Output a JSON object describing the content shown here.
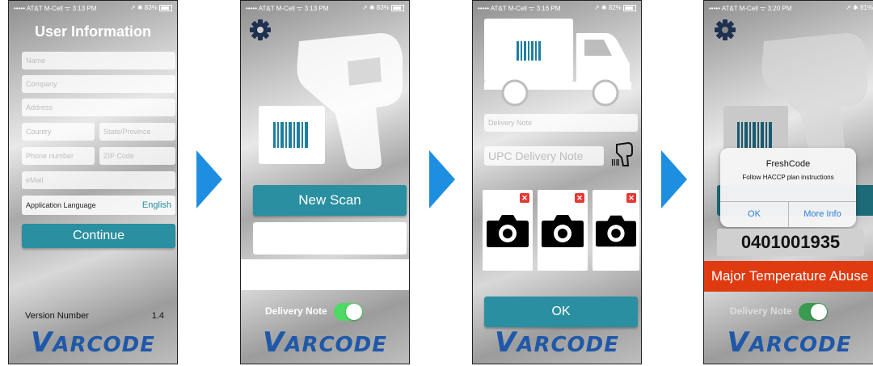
{
  "status_bars": [
    {
      "carrier": "••••• AT&T M-Cell ᯤ 3:13 PM",
      "battery": "↗ ✱ 83%"
    },
    {
      "carrier": "••••• AT&T M-Cell ᯤ 3:13 PM",
      "battery": "↗ ✱ 83%"
    },
    {
      "carrier": "••••• AT&T M-Cell ᯤ 3:16 PM",
      "battery": "↗ ✱ 82%"
    },
    {
      "carrier": "••••• AT&T M-Cell ᯤ 3:20 PM",
      "battery": "↗ ✱ 81%"
    }
  ],
  "screen1": {
    "title": "User Information",
    "placeholders": {
      "name": "Name",
      "company": "Company",
      "address": "Address",
      "country": "Country",
      "state": "State/Province",
      "phone": "Phone number",
      "zip": "ZIP Code",
      "email": "eMail"
    },
    "language_label": "Application Language",
    "language_value": "English",
    "continue_label": "Continue",
    "version_label": "Version Number",
    "version_value": "1.4"
  },
  "screen2": {
    "new_scan_label": "New Scan",
    "delivery_note_label": "Delivery Note"
  },
  "screen3": {
    "delivery_note_placeholder": "Delivery Note",
    "upc_placeholder": "UPC Delivery Note",
    "ok_label": "OK"
  },
  "screen4": {
    "dialog_title": "FreshCode",
    "dialog_message": "Follow HACCP plan instructions",
    "dialog_ok": "OK",
    "dialog_more": "More Info",
    "code": "0401001935",
    "alert": "Major Temperature Abuse",
    "delivery_note_label": "Delivery Note"
  },
  "brand": {
    "logo_v": "V",
    "logo_rest": "ARCODE"
  },
  "colors": {
    "teal": "#2a8fa0",
    "arrow": "#1e8fe0",
    "logo": "#1f58a8",
    "alert_red": "#e03a10",
    "dialog_blue": "#2f7fd8",
    "toggle_green": "#4cd964"
  }
}
